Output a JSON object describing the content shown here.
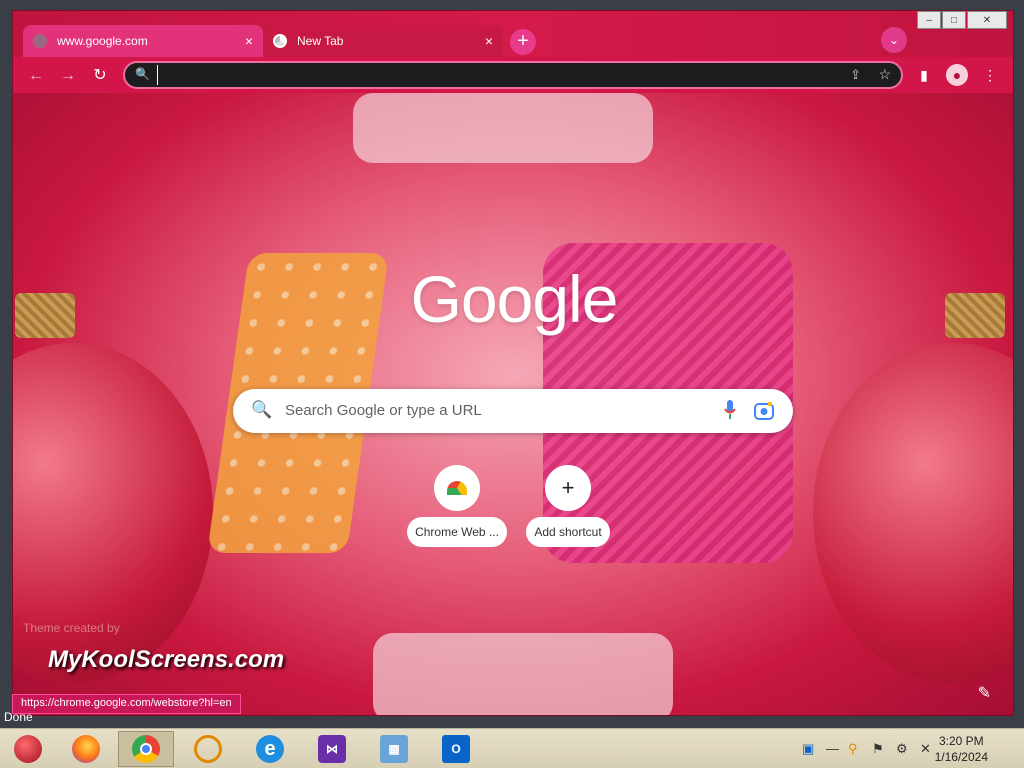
{
  "browser": {
    "tabs": [
      {
        "title": "www.google.com",
        "close": "×"
      },
      {
        "title": "New Tab",
        "close": "×"
      }
    ],
    "new_tab_symbol": "+",
    "window_controls": [
      "–",
      "□",
      "✕"
    ],
    "toolbar": {
      "back_icon": "←",
      "forward_icon": "→",
      "reload_icon": "↻",
      "omnibox_value": "",
      "share_icon": "⇪",
      "star_icon": "☆",
      "side_panel_icon": "▮",
      "menu_icon": "⋮"
    }
  },
  "new_tab_page": {
    "logo": "Google",
    "search_placeholder": "Search Google or type a URL",
    "shortcuts": [
      {
        "label": "Chrome Web ...",
        "icon": "chrome-web-store-icon"
      },
      {
        "label": "Add shortcut",
        "symbol": "+"
      }
    ],
    "theme_credit": "Theme created by",
    "edit_icon": "✎"
  },
  "status_bar": {
    "url": "https://chrome.google.com/webstore?hl=en",
    "behind_text": "Done"
  },
  "watermark": "MyKoolScreens.com",
  "taskbar": {
    "apps": [
      {
        "name": "start-ornament-icon"
      },
      {
        "name": "firefox-icon"
      },
      {
        "name": "chrome-icon",
        "active": true
      },
      {
        "name": "search-magnifier-icon"
      },
      {
        "name": "internet-explorer-icon",
        "glyph": "e"
      },
      {
        "name": "visual-studio-icon"
      },
      {
        "name": "control-panel-icon"
      },
      {
        "name": "outlook-icon",
        "glyph": "O"
      }
    ],
    "clock": {
      "time": "3:20 PM",
      "date": "1/16/2024"
    }
  },
  "colors": {
    "accent": "#c81844",
    "omnibox_border": "#f06ea2",
    "status_url_bg": "#c8185a"
  }
}
